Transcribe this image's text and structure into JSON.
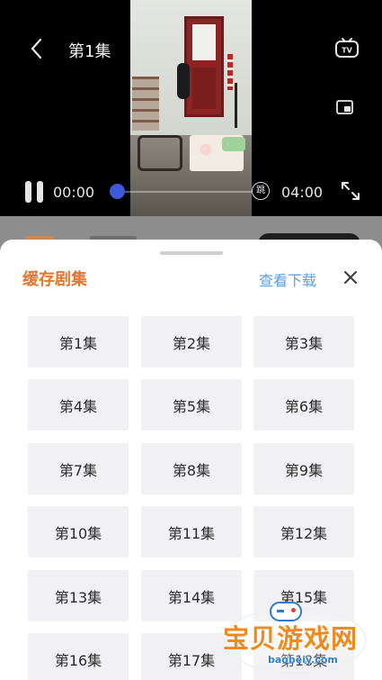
{
  "player": {
    "title": "第1集",
    "current_time": "00:00",
    "total_time": "04:00",
    "progress": 0.0,
    "skip_label": "跳",
    "icons": {
      "back": "chevron-left-icon",
      "tv": "tv-cast-icon",
      "pip": "picture-in-picture-icon",
      "pause": "pause-icon",
      "fullscreen": "fullscreen-icon"
    }
  },
  "sheet": {
    "title": "缓存剧集",
    "view_downloads": "查看下载",
    "close_icon": "close-icon",
    "episodes": [
      "第1集",
      "第2集",
      "第3集",
      "第4集",
      "第5集",
      "第6集",
      "第7集",
      "第8集",
      "第9集",
      "第10集",
      "第11集",
      "第12集",
      "第13集",
      "第14集",
      "第15集",
      "第16集",
      "第17集",
      "第18集"
    ]
  },
  "watermark": {
    "text": "宝贝游戏网",
    "sub": "baobeiy.com"
  },
  "colors": {
    "accent_orange": "#e0782f",
    "link_blue": "#5a9fe0",
    "progress_blue": "#3d58d8",
    "tile_bg": "#f1f1f3"
  }
}
